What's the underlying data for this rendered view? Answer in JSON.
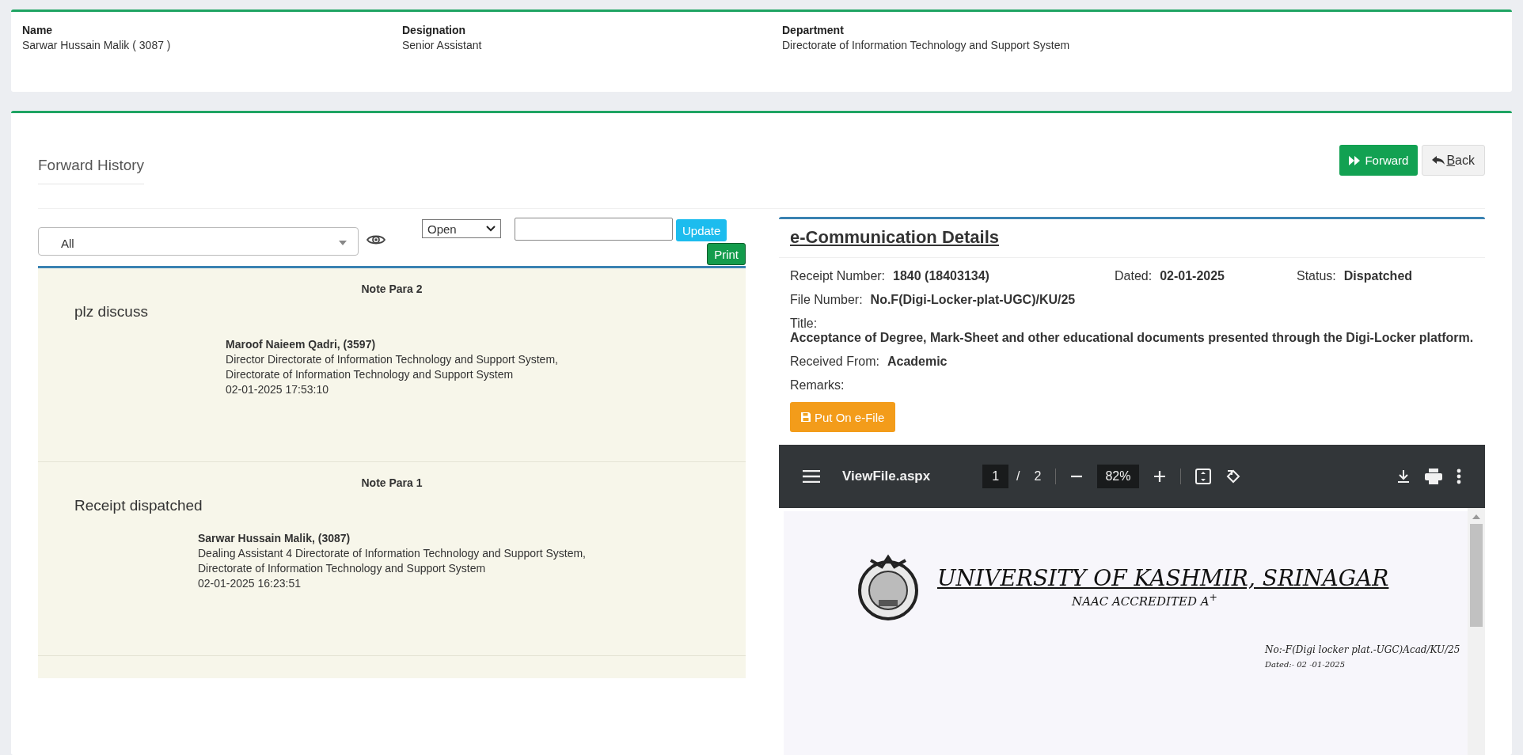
{
  "header": {
    "fields": [
      {
        "label": "Name",
        "value": "Sarwar Hussain Malik ( 3087 )"
      },
      {
        "label": "Designation",
        "value": "Senior Assistant"
      },
      {
        "label": "Department",
        "value": "Directorate of Information Technology and Support System"
      }
    ]
  },
  "forward_history": {
    "title": "Forward History",
    "buttons": [
      {
        "kind": "forward",
        "label": "Forward"
      },
      {
        "kind": "back",
        "label": "Back"
      }
    ]
  },
  "filters": {
    "user_select": "All",
    "status_select": "Open",
    "update_button": "Update",
    "print_button": "Print"
  },
  "notes": [
    {
      "title": "Note Para 2",
      "text": "plz discuss",
      "author": "Maroof Naieem Qadri, (3597)",
      "designation": "Director Directorate of Information Technology and Support System,",
      "department": "Directorate of Information Technology and Support System",
      "timestamp": "02-01-2025 17:53:10"
    },
    {
      "title": "Note Para 1",
      "text": "Receipt dispatched",
      "author": "Sarwar Hussain Malik, (3087)",
      "designation": "Dealing Assistant 4 Directorate of Information Technology and Support System,",
      "department": "Directorate of Information Technology and Support System",
      "timestamp": "02-01-2025 16:23:51"
    }
  ],
  "details": {
    "title": "e-Communication Details",
    "rows": [
      {
        "kind": "inline",
        "fields": [
          {
            "label": "Receipt Number:",
            "value": "1840 (18403134)"
          },
          {
            "label": "Dated:",
            "value": "02-01-2025"
          },
          {
            "label": "Status:",
            "value": "Dispatched"
          }
        ]
      },
      {
        "kind": "inline",
        "fields": [
          {
            "label": "File Number:",
            "value": "No.F(Digi-Locker-plat-UGC)/KU/25"
          }
        ]
      },
      {
        "kind": "stacked",
        "fields": [
          {
            "label": "Title:",
            "value": "Acceptance of Degree, Mark-Sheet and other educational documents presented through the Digi-Locker platform."
          }
        ]
      },
      {
        "kind": "inline",
        "fields": [
          {
            "label": "Received From:",
            "value": "Academic"
          }
        ]
      },
      {
        "kind": "inline",
        "fields": [
          {
            "label": "Remarks:"
          }
        ]
      }
    ],
    "action_button": "Put On e-File"
  },
  "pdf_viewer": {
    "file_name": "ViewFile.aspx",
    "page": "1",
    "page_separator": "/",
    "page_count": "2",
    "zoom": "82%",
    "document": {
      "heading": "UNIVERSITY OF KASHMIR, SRINAGAR",
      "subheading": "NAAC    ACCREDITED A$^{+}$",
      "reference": "No:-F(Digi locker plat.-UGC)Acad/KU/25",
      "date": "Dated:- 02 -01-2025"
    }
  }
}
